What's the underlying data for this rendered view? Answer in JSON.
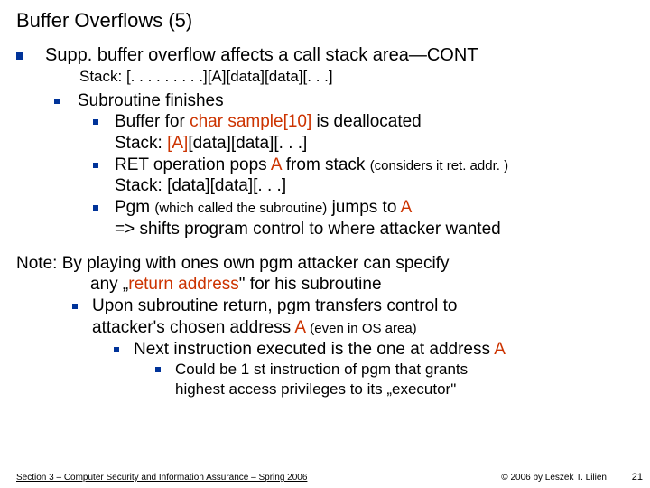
{
  "title": "Buffer Overflows (5)",
  "headline": "Supp. buffer overflow affects a call stack area—CONT",
  "stack0": "Stack: [. . . . . . . . .][A][data][data][. . .]",
  "sub1": "Subroutine finishes",
  "b1a_pre": "Buffer for ",
  "b1a_code": "char sample[10]",
  "b1a_post": " is  deallocated",
  "b1a_stack_pre": "Stack: ",
  "b1a_stack_mid": "[A]",
  "b1a_stack_post": "[data][data][. . .]",
  "b1b_pre": "RET operation pops ",
  "b1b_A": "A",
  "b1b_post": " from stack ",
  "b1b_note": "(considers it ret. addr. )",
  "b1b_stack": "Stack: [data][data][. . .]",
  "b1c_pre": "Pgm ",
  "b1c_note": "(which called the subroutine)",
  "b1c_mid": " jumps to ",
  "b1c_A": "A",
  "b1c_line2": "=> shifts program control to where attacker wanted",
  "note_l1a": "Note: By playing with ones own pgm attacker can specify",
  "note_l1b_pre": "any „",
  "note_l1b_ret": "return address",
  "note_l1b_post": "\" for his subroutine",
  "note_l2a": "Upon subroutine return, pgm transfers control to",
  "note_l2b_pre": "attacker's chosen address ",
  "note_l2b_A": "A",
  "note_l2b_post": " ",
  "note_l2b_note": "(even in OS area)",
  "note_l3_pre": "Next instruction executed is the one at address ",
  "note_l3_A": "A",
  "note_l4a": "Could be 1 st instruction of pgm that grants",
  "note_l4b": "highest access privileges to its „executor\"",
  "footer": "Section 3 – Computer Security and Information Assurance – Spring 2006",
  "copyright": "© 2006 by Leszek T. Lilien",
  "pagenum": "21"
}
